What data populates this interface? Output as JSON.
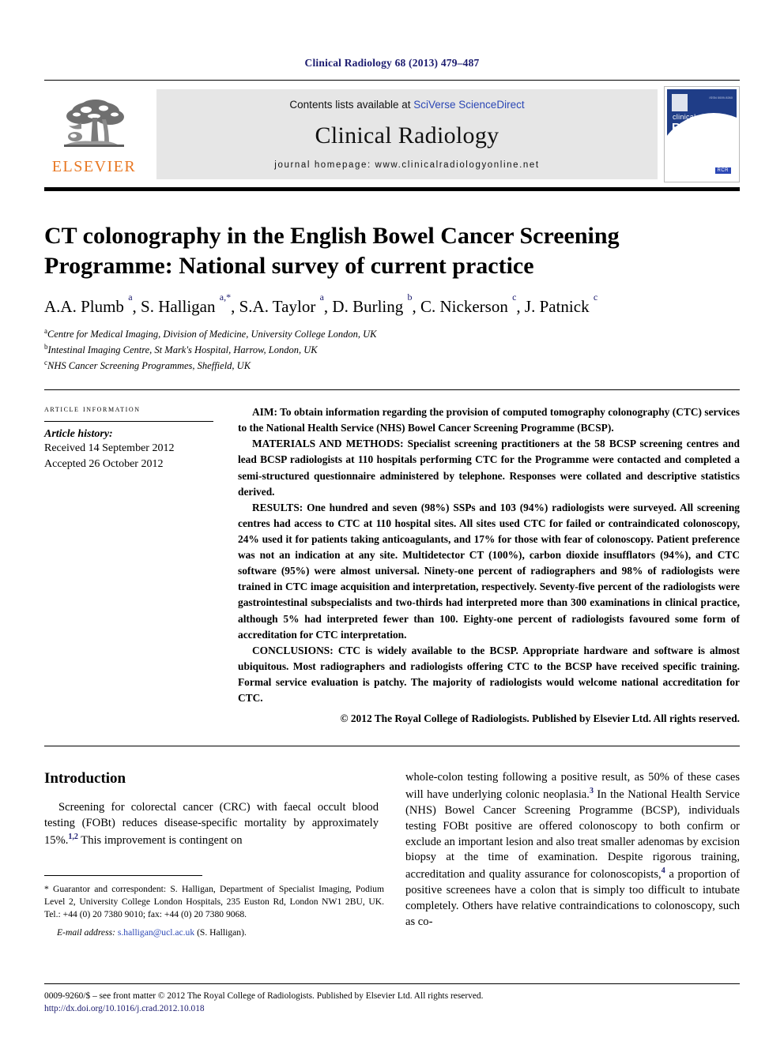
{
  "running_head": "Clinical Radiology 68 (2013) 479–487",
  "header": {
    "publisher_name": "ELSEVIER",
    "contents_prefix": "Contents lists available at ",
    "contents_link": "SciVerse ScienceDirect",
    "journal_name": "Clinical Radiology",
    "homepage_line": "journal homepage: www.clinicalradiologyonline.net",
    "cover": {
      "top_label": "clinical",
      "main_label": "RADIOLOGY",
      "badge": "RCR",
      "corner_text": "ISSN 0009-9260"
    }
  },
  "article": {
    "title": "CT colonography in the English Bowel Cancer Screening Programme: National survey of current practice",
    "authors_html": "A.A. Plumb <sup>a</sup>, S. Halligan <sup>a,</sup><sup>*</sup>, S.A. Taylor <sup>a</sup>, D. Burling <sup>b</sup>, C. Nickerson <sup>c</sup>, J. Patnick <sup>c</sup>",
    "affiliations": [
      {
        "marker": "a",
        "text": "Centre for Medical Imaging, Division of Medicine, University College London, UK"
      },
      {
        "marker": "b",
        "text": "Intestinal Imaging Centre, St Mark's Hospital, Harrow, London, UK"
      },
      {
        "marker": "c",
        "text": "NHS Cancer Screening Programmes, Sheffield, UK"
      }
    ]
  },
  "article_info": {
    "heading": "ARTICLE INFORMATION",
    "history_label": "Article history:",
    "received": "Received 14 September 2012",
    "accepted": "Accepted 26 October 2012"
  },
  "abstract": {
    "aim": "AIM: To obtain information regarding the provision of computed tomography colonography (CTC) services to the National Health Service (NHS) Bowel Cancer Screening Programme (BCSP).",
    "materials": "MATERIALS AND METHODS: Specialist screening practitioners at the 58 BCSP screening centres and lead BCSP radiologists at 110 hospitals performing CTC for the Programme were contacted and completed a semi-structured questionnaire administered by telephone. Responses were collated and descriptive statistics derived.",
    "results": "RESULTS: One hundred and seven (98%) SSPs and 103 (94%) radiologists were surveyed. All screening centres had access to CTC at 110 hospital sites. All sites used CTC for failed or contraindicated colonoscopy, 24% used it for patients taking anticoagulants, and 17% for those with fear of colonoscopy. Patient preference was not an indication at any site. Multidetector CT (100%), carbon dioxide insufflators (94%), and CTC software (95%) were almost universal. Ninety-one percent of radiographers and 98% of radiologists were trained in CTC image acquisition and interpretation, respectively. Seventy-five percent of the radiologists were gastrointestinal subspecialists and two-thirds had interpreted more than 300 examinations in clinical practice, although 5% had interpreted fewer than 100. Eighty-one percent of radiologists favoured some form of accreditation for CTC interpretation.",
    "conclusions": "CONCLUSIONS: CTC is widely available to the BCSP. Appropriate hardware and software is almost ubiquitous. Most radiographers and radiologists offering CTC to the BCSP have received specific training. Formal service evaluation is patchy. The majority of radiologists would welcome national accreditation for CTC.",
    "copyright": "© 2012 The Royal College of Radiologists. Published by Elsevier Ltd. All rights reserved."
  },
  "introduction": {
    "heading": "Introduction",
    "left_paragraph_html": "Screening for colorectal cancer (CRC) with faecal occult blood testing (FOBt) reduces disease-specific mortality by approximately 15%.<sup>1,2</sup> This improvement is contingent on",
    "right_paragraph_html": "whole-colon testing following a positive result, as 50% of these cases will have underlying colonic neoplasia.<sup>3</sup> In the National Health Service (NHS) Bowel Cancer Screening Programme (BCSP), individuals testing FOBt positive are offered colonoscopy to both confirm or exclude an important lesion and also treat smaller adenomas by excision biopsy at the time of examination. Despite rigorous training, accreditation and quality assurance for colonoscopists,<sup>4</sup> a proportion of positive screenees have a colon that is simply too difficult to intubate completely. Others have relative contraindications to colonoscopy, such as co-"
  },
  "footnote": {
    "correspondence_html": "* Guarantor and correspondent: S. Halligan, Department of Specialist Imaging, Podium Level 2, University College London Hospitals, 235 Euston Rd, London NW1 2BU, UK. Tel.: +44 (0) 20 7380 9010; fax: +44 (0) 20 7380 9068.",
    "email_label": "E-mail address:",
    "email_address": "s.halligan@ucl.ac.uk",
    "email_owner": "(S. Halligan)."
  },
  "bottom": {
    "issn_line": "0009-9260/$ – see front matter © 2012 The Royal College of Radiologists. Published by Elsevier Ltd. All rights reserved.",
    "doi": "http://dx.doi.org/10.1016/j.crad.2012.10.018"
  },
  "colors": {
    "running_head": "#1a1a6e",
    "link_blue": "#2b47b5",
    "elsevier_orange": "#e87722",
    "banner_gray": "#e6e6e6",
    "cover_blue": "#1f3d87"
  }
}
